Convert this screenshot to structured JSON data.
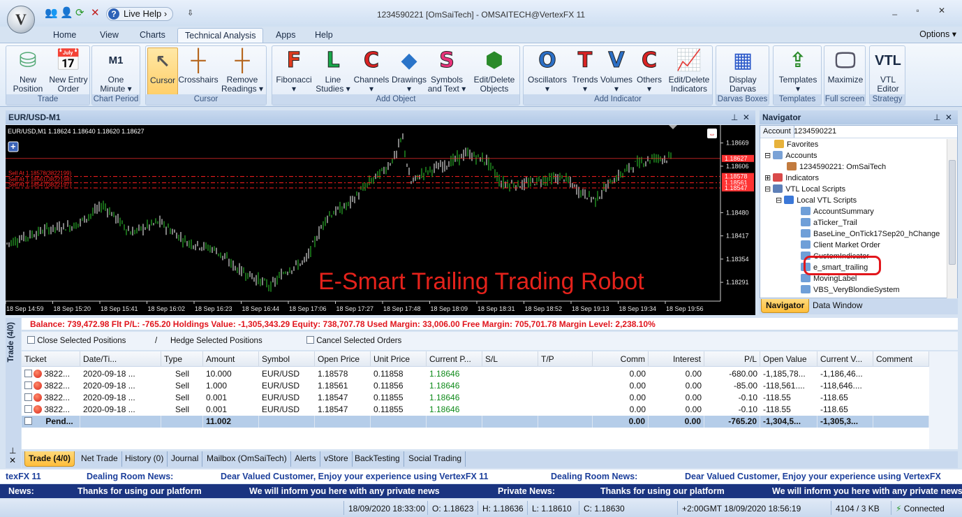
{
  "window": {
    "title": "1234590221 [OmSaiTech] - OMSAITECH@VertexFX 11",
    "live_help": "Live Help",
    "controls": "_ ▫ ✕"
  },
  "menu": {
    "tabs": [
      "Home",
      "View",
      "Charts",
      "Technical Analysis",
      "Apps",
      "Help"
    ],
    "active_tab": "Technical Analysis",
    "options": "Options"
  },
  "ribbon": {
    "groups": {
      "trade": "Trade",
      "chart_period": "Chart Period",
      "cursor": "Cursor",
      "add_object": "Add Object",
      "add_indicator": "Add Indicator",
      "darvas": "Darvas Boxes",
      "templates": "Templates",
      "fullscreen": "Full screen",
      "strategy": "Strategy"
    },
    "buttons": {
      "new_position": [
        "New",
        "Position"
      ],
      "new_entry_order": [
        "New Entry",
        "Order"
      ],
      "one_minute": [
        "One",
        "Minute ▾"
      ],
      "one_minute_icon": "M1",
      "cursor": "Cursor",
      "crosshairs": "Crosshairs",
      "remove_readings": [
        "Remove",
        "Readings ▾"
      ],
      "fibonacci": [
        "Fibonacci",
        "▾"
      ],
      "line_studies": [
        "Line",
        "Studies ▾"
      ],
      "channels": [
        "Channels",
        "▾"
      ],
      "drawings": [
        "Drawings",
        "▾"
      ],
      "symbols_text": [
        "Symbols",
        "and Text ▾"
      ],
      "edit_delete_objects": [
        "Edit/Delete",
        "Objects"
      ],
      "oscillators": [
        "Oscillators",
        "▾"
      ],
      "trends": [
        "Trends",
        "▾"
      ],
      "volumes": [
        "Volumes",
        "▾"
      ],
      "others": [
        "Others",
        "▾"
      ],
      "edit_delete_indicators": [
        "Edit/Delete",
        "Indicators"
      ],
      "display_darvas": [
        "Display",
        "Darvas Boxes"
      ],
      "templates": [
        "Templates",
        "▾"
      ],
      "maximize": "Maximize",
      "vtl_editor": [
        "VTL",
        "Editor"
      ],
      "vtl_icon": "VTL"
    },
    "letters": {
      "fib": "F",
      "line": "L",
      "channels": "C",
      "symbols": "S",
      "osc": "O",
      "trends": "T",
      "volumes": "V",
      "others": "C"
    }
  },
  "chart": {
    "header": "EUR/USD-M1",
    "ohlc_label": "EUR/USD,M1  1.18624  1.18640  1.18620  1.18627",
    "watermark": "E-Smart Trailing Trading Robot",
    "sell_labels": [
      "Sell At 1.18578(3822199)",
      "Sell At 1.18561(3822198)",
      "Sell At 1.18547(3822197)"
    ],
    "price_axis": [
      "1.18669",
      "1.18606",
      "1.18480",
      "1.18417",
      "1.18354",
      "1.18291"
    ],
    "price_tags": {
      "current": "1.18627",
      "sells": [
        "1.18578",
        "1.18561",
        "1.18547"
      ]
    },
    "time_axis": [
      "18 Sep 14:59",
      "18 Sep 15:20",
      "18 Sep 15:41",
      "18 Sep 16:02",
      "18 Sep 16:23",
      "18 Sep 16:44",
      "18 Sep 17:06",
      "18 Sep 17:27",
      "18 Sep 17:48",
      "18 Sep 18:09",
      "18 Sep 18:31",
      "18 Sep 18:52",
      "18 Sep 19:13",
      "18 Sep 19:34",
      "18 Sep 19:56"
    ],
    "colors": {
      "bull": "#ffffff",
      "bear": "#2fd12f",
      "sell_line": "#ff2020",
      "current": "#ff3333"
    }
  },
  "navigator": {
    "title": "Navigator",
    "account_label": "Account",
    "account_value": "1234590221",
    "tree": [
      "Favorites",
      "Accounts",
      "1234590221: OmSaiTech",
      "Indicators",
      "VTL Local Scripts",
      "Local VTL Scripts",
      "AccountSummary",
      "aTicker_Trail",
      "BaseLine_OnTick17Sep20_hChange",
      "Client Market Order",
      "CustomIndicator",
      "e_smart_trailing",
      "MovingLabel",
      "VBS_VeryBlondieSystem"
    ],
    "tabs": [
      "Navigator",
      "Data Window"
    ]
  },
  "terminal": {
    "side_label": "Trade (4/0)",
    "balance_line": "Balance: 739,472.98  Flt P/L: -765.20  Holdings Value: -1,305,343.29  Equity: 738,707.78  Used Margin: 33,006.00  Free Margin: 705,701.78  Margin Level: 2,238.10%",
    "actions": [
      "Close Selected Positions",
      "Hedge Selected Positions",
      "Cancel Selected Orders"
    ],
    "separator": "/",
    "columns": [
      "Ticket",
      "Date/Ti...",
      "Type",
      "Amount",
      "Symbol",
      "Open Price",
      "Unit Price",
      "Current P...",
      "S/L",
      "T/P",
      "Comm",
      "Interest",
      "P/L",
      "Open Value",
      "Current V...",
      "Comment"
    ],
    "rows": [
      [
        "3822...",
        "2020-09-18 ...",
        "Sell",
        "10.000",
        "EUR/USD",
        "1.18578",
        "0.11858",
        "1.18646",
        "",
        "",
        "0.00",
        "0.00",
        "-680.00",
        "-1,185,78...",
        "-1,186,46...",
        ""
      ],
      [
        "3822...",
        "2020-09-18 ...",
        "Sell",
        "1.000",
        "EUR/USD",
        "1.18561",
        "0.11856",
        "1.18646",
        "",
        "",
        "0.00",
        "0.00",
        "-85.00",
        "-118,561....",
        "-118,646....",
        ""
      ],
      [
        "3822...",
        "2020-09-18 ...",
        "Sell",
        "0.001",
        "EUR/USD",
        "1.18547",
        "0.11855",
        "1.18646",
        "",
        "",
        "0.00",
        "0.00",
        "-0.10",
        "-118.55",
        "-118.65",
        ""
      ],
      [
        "3822...",
        "2020-09-18 ...",
        "Sell",
        "0.001",
        "EUR/USD",
        "1.18547",
        "0.11855",
        "1.18646",
        "",
        "",
        "0.00",
        "0.00",
        "-0.10",
        "-118.55",
        "-118.65",
        ""
      ]
    ],
    "pending_row": [
      "Pend...",
      "",
      "",
      "11.002",
      "",
      "",
      "",
      "",
      "",
      "",
      "0.00",
      "0.00",
      "-765.20",
      "-1,304,5...",
      "-1,305,3...",
      ""
    ],
    "tabs": [
      "Trade (4/0)",
      "Net Trade",
      "History (0)",
      "Journal",
      "Mailbox (OmSaiTech)",
      "Alerts",
      "vStore",
      "BackTesting",
      "Social Trading"
    ]
  },
  "tickers": {
    "line1": [
      "texFX 11",
      "Dealing Room News:",
      "Dear Valued Customer, Enjoy your experience using VertexFX 11",
      "Dealing Room News:",
      "Dear Valued Customer, Enjoy your experience using VertexFX"
    ],
    "line2": [
      "News:",
      "Thanks for using our platform",
      "We will inform you here with any private news",
      "Private News:",
      "Thanks for using our platform",
      "We will inform you here with any private news"
    ]
  },
  "status": {
    "datetime": "18/09/2020 18:33:00",
    "open": "O: 1.18623",
    "high": "H: 1.18636",
    "low": "L: 1.18610",
    "close": "C: 1.18630",
    "server": "+2:00GMT  18/09/2020 18:56:19",
    "traffic": "4104 / 3 KB",
    "connection": "Connected"
  }
}
